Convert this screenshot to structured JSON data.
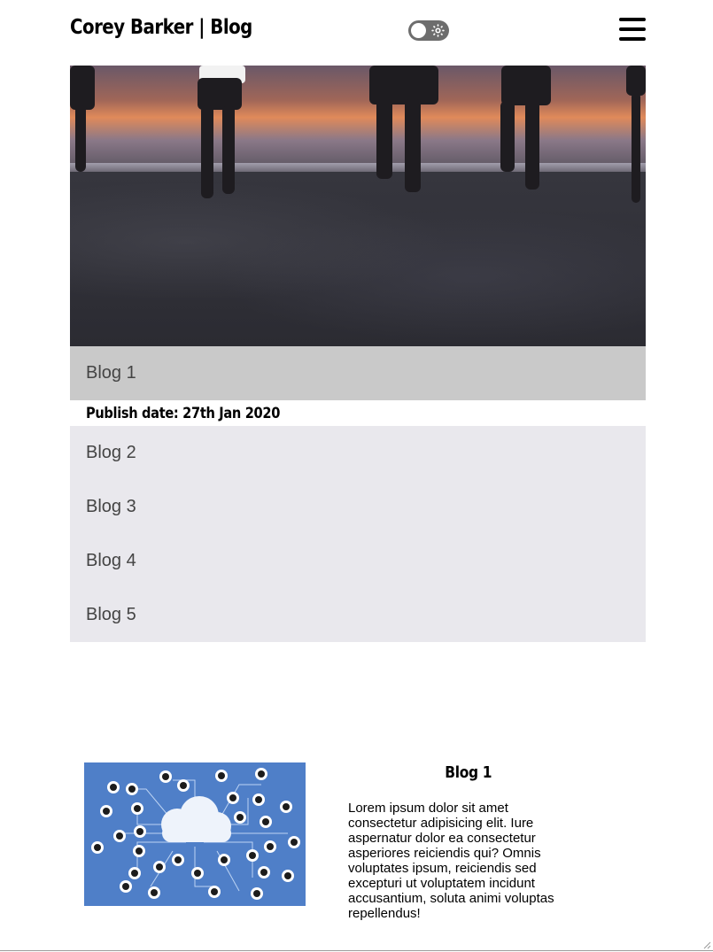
{
  "header": {
    "title": "Corey Barker | Blog",
    "toggle_icon": "sun-icon",
    "menu_icon": "hamburger-icon"
  },
  "hero": {
    "description_icon": "hero-photo"
  },
  "blog_list": {
    "items": [
      {
        "label": "Blog 1",
        "active": true
      },
      {
        "label": "Blog 2",
        "active": false
      },
      {
        "label": "Blog 3",
        "active": false
      },
      {
        "label": "Blog 4",
        "active": false
      },
      {
        "label": "Blog 5",
        "active": false
      }
    ],
    "publish_date": "Publish date: 27th Jan 2020"
  },
  "article": {
    "title": "Blog 1",
    "body": "Lorem ipsum dolor sit amet consectetur adipisicing elit. Iure aspernatur dolor ea consectetur asperiores reiciendis qui? Omnis voluptates ipsum, reiciendis sed excepturi ut voluptatem incidunt accusantium, soluta animi voluptas repellendus!",
    "image_icon": "cloud-network-illustration"
  },
  "colors": {
    "active_item_bg": "#c9c9c9",
    "list_bg": "#e9e8ed",
    "illustration_bg": "#4f7fc8"
  }
}
